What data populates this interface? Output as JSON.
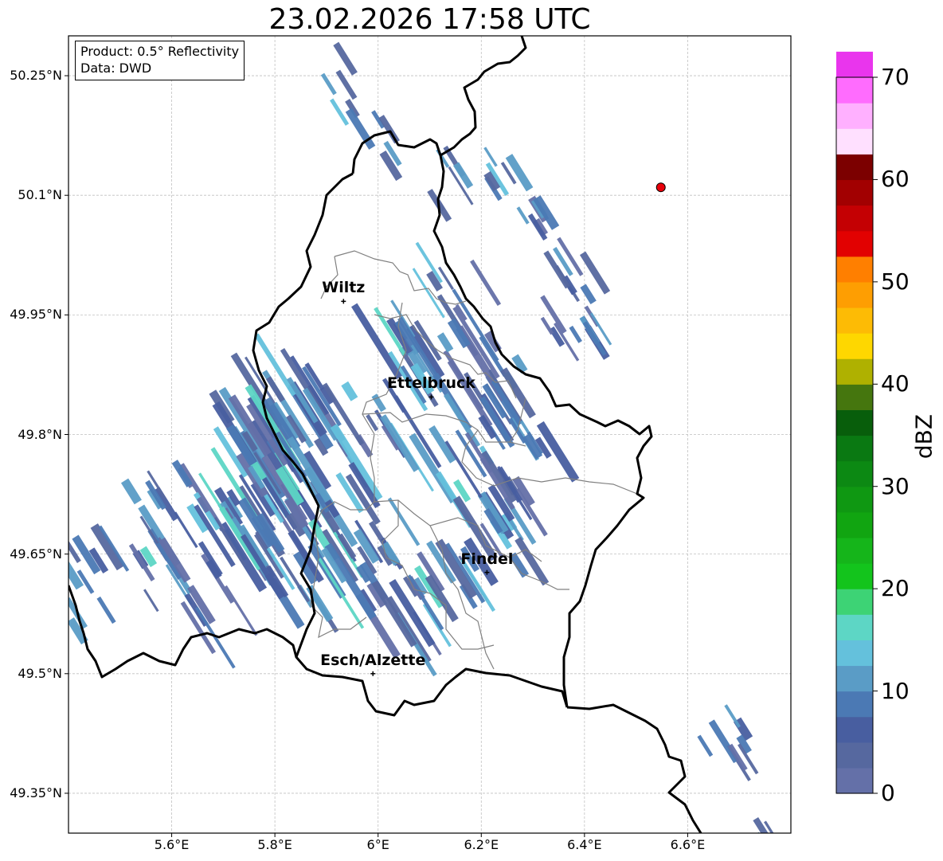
{
  "title": "23.02.2026 17:58 UTC",
  "info_box": {
    "product_line": "Product: 0.5° Reflectivity",
    "data_line": "Data: DWD"
  },
  "map": {
    "lon_range": [
      5.4,
      6.8
    ],
    "lat_range": [
      49.3,
      50.3
    ],
    "lat_ticks": [
      {
        "value": 50.25,
        "label": "50.25°N"
      },
      {
        "value": 50.1,
        "label": "50.1°N"
      },
      {
        "value": 49.95,
        "label": "49.95°N"
      },
      {
        "value": 49.8,
        "label": "49.8°N"
      },
      {
        "value": 49.65,
        "label": "49.65°N"
      },
      {
        "value": 49.5,
        "label": "49.5°N"
      },
      {
        "value": 49.35,
        "label": "49.35°N"
      }
    ],
    "lon_ticks": [
      {
        "value": 5.6,
        "label": "5.6°E"
      },
      {
        "value": 5.8,
        "label": "5.8°E"
      },
      {
        "value": 6.0,
        "label": "6°E"
      },
      {
        "value": 6.2,
        "label": "6.2°E"
      },
      {
        "value": 6.4,
        "label": "6.4°E"
      },
      {
        "value": 6.6,
        "label": "6.6°E"
      }
    ],
    "gridlines": true,
    "cities": [
      {
        "name": "Wiltz",
        "lon": 5.933,
        "lat": 49.967
      },
      {
        "name": "Ettelbruck",
        "lon": 6.103,
        "lat": 49.847
      },
      {
        "name": "Findel",
        "lon": 6.211,
        "lat": 49.627
      },
      {
        "name": "Esch/Alzette",
        "lon": 5.99,
        "lat": 49.5
      }
    ],
    "radar_site": {
      "lon": 6.548,
      "lat": 50.11,
      "color": "#e8000b"
    },
    "colors": {
      "border": "#000000",
      "district": "#808080",
      "grid": "#c0c0c0"
    }
  },
  "colorbar": {
    "label": "dBZ",
    "min": 0,
    "max": 70,
    "step": 2.5,
    "ticks": [
      "0",
      "10",
      "20",
      "30",
      "40",
      "50",
      "60",
      "70"
    ],
    "colors": [
      "#6470a8",
      "#56689f",
      "#485ea0",
      "#4b79b4",
      "#5a9cc6",
      "#64c1dc",
      "#5dd6c5",
      "#3dd375",
      "#13c41c",
      "#15b51a",
      "#11a511",
      "#0f9812",
      "#0c8913",
      "#0a7912",
      "#085e0b",
      "#45760e",
      "#afb100",
      "#fed700",
      "#fdbb05",
      "#fe9e02",
      "#ff7f00",
      "#e20101",
      "#c40003",
      "#a20001",
      "#7c0000",
      "#ffe0ff",
      "#ffb0ff",
      "#ff6cfe",
      "#e935ed"
    ]
  }
}
